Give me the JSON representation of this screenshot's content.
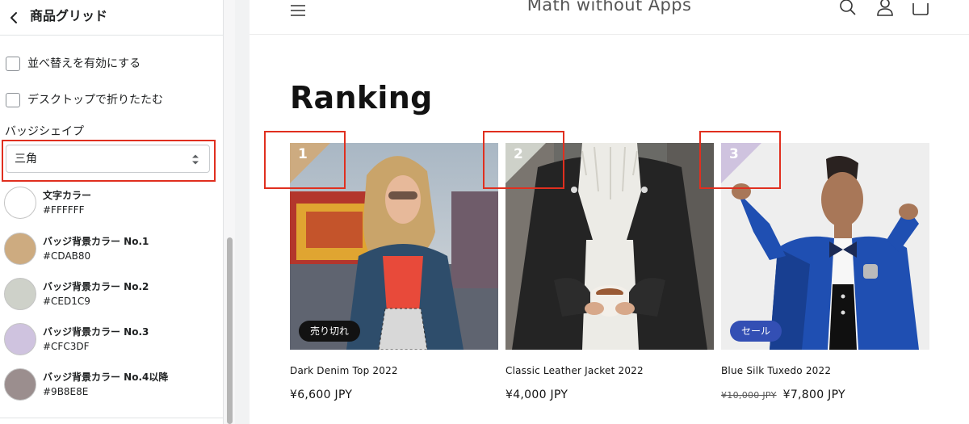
{
  "panel": {
    "title": "商品グリッド",
    "checkboxes": [
      {
        "label": "並べ替えを有効にする",
        "checked": false
      },
      {
        "label": "デスクトップで折りたたむ",
        "checked": false
      }
    ],
    "badge_shape": {
      "label": "バッジシェイプ",
      "value": "三角"
    },
    "colors": [
      {
        "name": "文字カラー",
        "hex": "#FFFFFF"
      },
      {
        "name": "バッジ背景カラー No.1",
        "hex": "#CDAB80"
      },
      {
        "name": "バッジ背景カラー No.2",
        "hex": "#CED1C9"
      },
      {
        "name": "バッジ背景カラー No.3",
        "hex": "#CFC3DF"
      },
      {
        "name": "バッジ背景カラー No.4以降",
        "hex": "#9B8E8E"
      }
    ]
  },
  "store": {
    "name": "Math without Apps",
    "icons": [
      "menu-icon",
      "search-icon",
      "account-icon",
      "cart-icon"
    ]
  },
  "section": {
    "title": "Ranking"
  },
  "products": [
    {
      "rank": "1",
      "title": "Dark Denim Top 2022",
      "price": "¥6,600 JPY",
      "compare_price": "",
      "badge": "売り切れ",
      "badge_color": "#121212",
      "rank_color": "#CDAB80"
    },
    {
      "rank": "2",
      "title": "Classic Leather Jacket 2022",
      "price": "¥4,000 JPY",
      "compare_price": "",
      "badge": "",
      "badge_color": "",
      "rank_color": "#CED1C9"
    },
    {
      "rank": "3",
      "title": "Blue Silk Tuxedo 2022",
      "price": "¥7,800 JPY",
      "compare_price": "¥10,000 JPY",
      "badge": "セール",
      "badge_color": "#334fb4",
      "rank_color": "#CFC3DF"
    }
  ],
  "colors": {
    "highlight": "#e02f1f",
    "accent_sale": "#334fb4"
  }
}
